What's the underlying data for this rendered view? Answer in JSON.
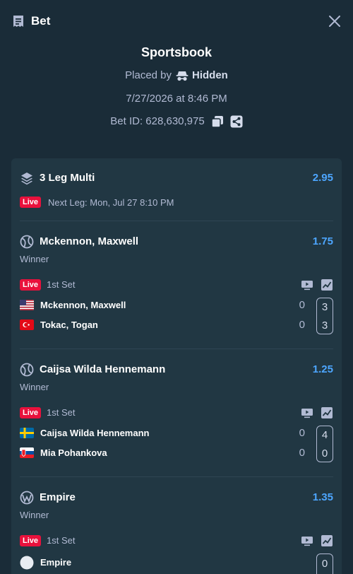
{
  "header": {
    "title": "Bet"
  },
  "summary": {
    "book": "Sportsbook",
    "placed_by_label": "Placed by",
    "placed_by_user": "Hidden",
    "date": "7/27/2026 at 8:46 PM",
    "bet_id": "Bet ID: 628,630,975"
  },
  "multi": {
    "name": "3 Leg Multi",
    "odds": "2.95",
    "live_label": "Live",
    "next_leg": "Next Leg: Mon, Jul 27 8:10 PM"
  },
  "legs": [
    {
      "name": "Mckennon, Maxwell",
      "odds": "1.75",
      "market": "Winner",
      "live_label": "Live",
      "period": "1st Set",
      "teams": [
        {
          "name": "Mckennon, Maxwell",
          "games": "0",
          "set": "3",
          "flag": "us-flag-icon"
        },
        {
          "name": "Tokac, Togan",
          "games": "0",
          "set": "3",
          "flag": "turkey-flag-icon"
        }
      ]
    },
    {
      "name": "Caijsa Wilda Hennemann",
      "odds": "1.25",
      "market": "Winner",
      "live_label": "Live",
      "period": "1st Set",
      "teams": [
        {
          "name": "Caijsa Wilda Hennemann",
          "games": "0",
          "set": "4",
          "flag": "sweden-flag-icon"
        },
        {
          "name": "Mia Pohankova",
          "games": "0",
          "set": "0",
          "flag": "slovakia-flag-icon"
        }
      ]
    },
    {
      "name": "Empire",
      "odds": "1.35",
      "market": "Winner",
      "live_label": "Live",
      "period": "1st Set",
      "teams": [
        {
          "name": "Empire",
          "games": "",
          "set": "0",
          "flag": "team-logo-icon"
        }
      ]
    }
  ],
  "colors": {
    "background": "#1a2c38",
    "card": "#213743",
    "odds": "#4da6ff",
    "live": "#e9113c",
    "text": "#b1bad3"
  }
}
